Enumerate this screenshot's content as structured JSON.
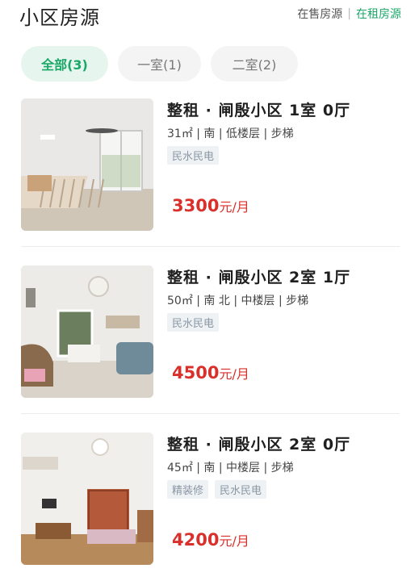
{
  "header": {
    "title": "小区房源",
    "link_sale": "在售房源",
    "link_separator": "|",
    "link_rent": "在租房源"
  },
  "filters": [
    {
      "label": "全部(3)",
      "active": true
    },
    {
      "label": "一室(1)",
      "active": false
    },
    {
      "label": "二室(2)",
      "active": false
    }
  ],
  "listings": [
    {
      "title": "整租 · 闸殷小区 1室 0厅",
      "meta": "31㎡ | 南 | 低楼层 | 步梯",
      "tags": [
        "民水民电"
      ],
      "price": "3300",
      "price_unit": "元/月"
    },
    {
      "title": "整租 · 闸殷小区 2室 1厅",
      "meta": "50㎡ | 南 北 | 中楼层 | 步梯",
      "tags": [
        "民水民电"
      ],
      "price": "4500",
      "price_unit": "元/月"
    },
    {
      "title": "整租 · 闸殷小区 2室 0厅",
      "meta": "45㎡ | 南 | 中楼层 | 步梯",
      "tags": [
        "精装修",
        "民水民电"
      ],
      "price": "4200",
      "price_unit": "元/月"
    }
  ],
  "colors": {
    "accent_green": "#1aa868",
    "price_red": "#d9302c",
    "tag_bg": "#eef2f5"
  }
}
